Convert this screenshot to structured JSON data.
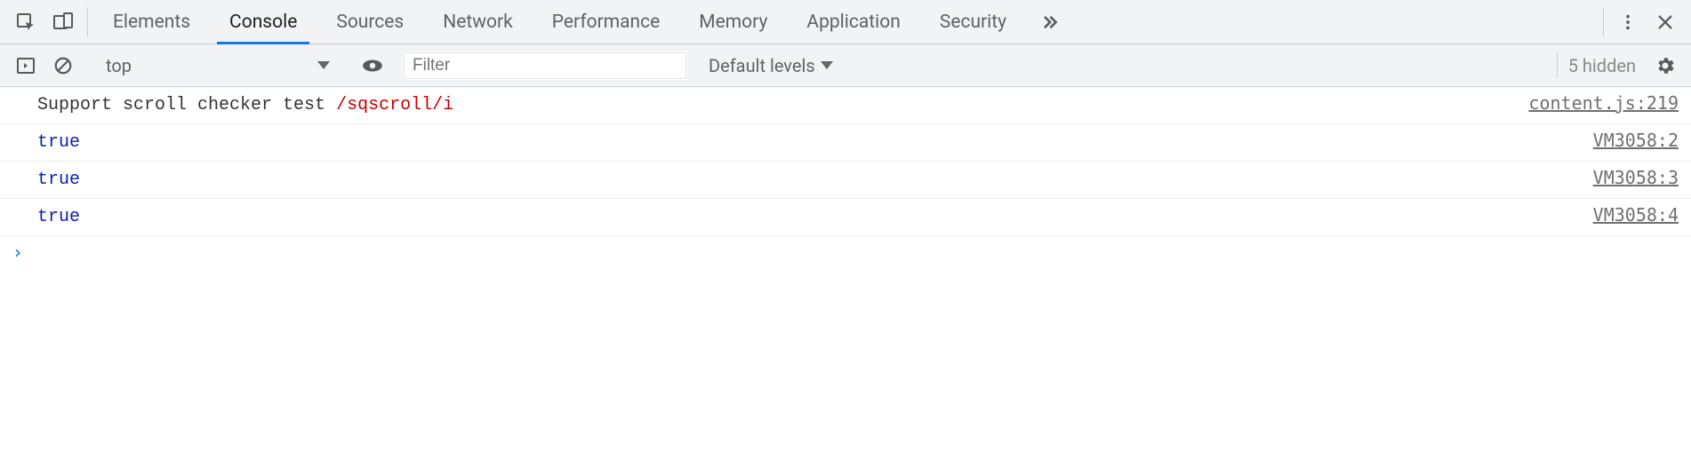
{
  "tabs": {
    "items": [
      {
        "label": "Elements",
        "active": false
      },
      {
        "label": "Console",
        "active": true
      },
      {
        "label": "Sources",
        "active": false
      },
      {
        "label": "Network",
        "active": false
      },
      {
        "label": "Performance",
        "active": false
      },
      {
        "label": "Memory",
        "active": false
      },
      {
        "label": "Application",
        "active": false
      },
      {
        "label": "Security",
        "active": false
      }
    ]
  },
  "toolbar": {
    "context": "top",
    "filter_placeholder": "Filter",
    "levels_label": "Default levels",
    "hidden_label": "5 hidden"
  },
  "log": {
    "rows": [
      {
        "text": "Support scroll checker test ",
        "regex": "/sqscroll/i",
        "src": "content.js:219"
      },
      {
        "bool": "true",
        "src": "VM3058:2"
      },
      {
        "bool": "true",
        "src": "VM3058:3"
      },
      {
        "bool": "true",
        "src": "VM3058:4"
      }
    ]
  }
}
